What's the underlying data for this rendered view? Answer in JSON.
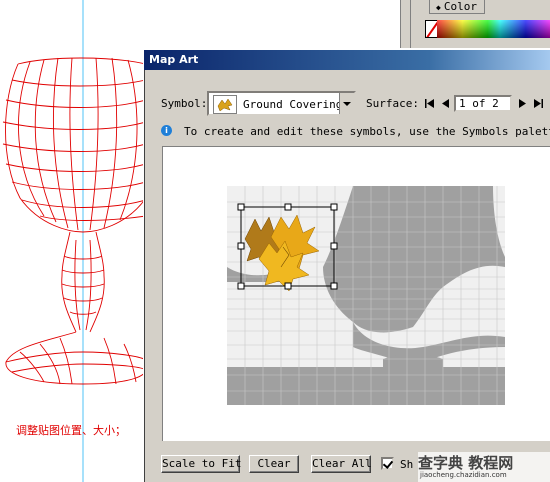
{
  "canvas": {
    "caption": "调整贴图位置、大小；"
  },
  "color_panel": {
    "tab_label": "Color",
    "none_swatch_color": "#ff0000"
  },
  "dialog": {
    "title": "Map Art",
    "symbol_label": "Symbol:",
    "symbol_value": "Ground Covering",
    "surface_label": "Surface:",
    "surface_value": "1 of 2",
    "info_text": "To create and edit these symbols, use the Symbols palette.",
    "buttons": {
      "scale_to_fit": "Scale to Fit",
      "clear": "Clear",
      "clear_all": "Clear All"
    },
    "shade_label": "Sh",
    "shade_checked": true
  },
  "watermark": {
    "main": "查字典 教程网",
    "url": "jiaocheng.chazidian.com"
  },
  "colors": {
    "title_bar": "#0a246a",
    "wireframe": "#ff0000",
    "map_shape": "#a0a0a0",
    "dialog_bg": "#d4d0c8"
  }
}
